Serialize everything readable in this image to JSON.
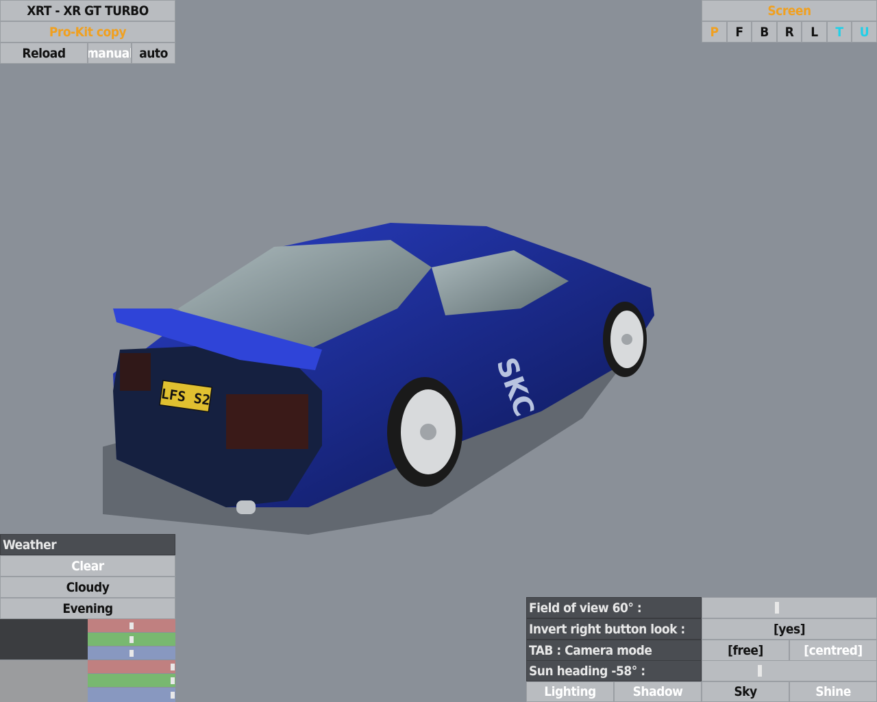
{
  "top_left": {
    "car_name": "XRT - XR GT TURBO",
    "skin_name": "Pro-Kit copy",
    "reload_label": "Reload",
    "manual_label": "manual",
    "auto_label": "auto"
  },
  "screen_panel": {
    "title": "Screen",
    "buttons": [
      "P",
      "F",
      "B",
      "R",
      "L",
      "T",
      "U"
    ]
  },
  "car": {
    "plate_text": "LFS S2",
    "decal_text": "SKC"
  },
  "weather": {
    "title": "Weather",
    "options": [
      "Clear",
      "Cloudy",
      "Evening"
    ],
    "color1_levels": {
      "red": 0.5,
      "green": 0.5,
      "blue": 0.5
    },
    "color2_levels": {
      "red": 0.97,
      "green": 0.97,
      "blue": 0.97
    }
  },
  "view_settings": {
    "fov_label": "Field of view 60° :",
    "fov_value": 0.43,
    "invert_label": "Invert right button look :",
    "invert_value": "[yes]",
    "camera_label": "TAB : Camera mode",
    "camera_options": [
      "[free]",
      "[centred]"
    ],
    "sun_label": "Sun heading -58° :",
    "sun_value": 0.33,
    "tabs": [
      "Lighting",
      "Shadow",
      "Sky",
      "Shine"
    ]
  },
  "colors": {
    "background": "#8a9098",
    "button": "#b9bcc0",
    "dark_label": "#4a4d52",
    "accent_orange": "#f0a020",
    "accent_cyan": "#20d0e8",
    "car_body": "#1a2fa0"
  }
}
